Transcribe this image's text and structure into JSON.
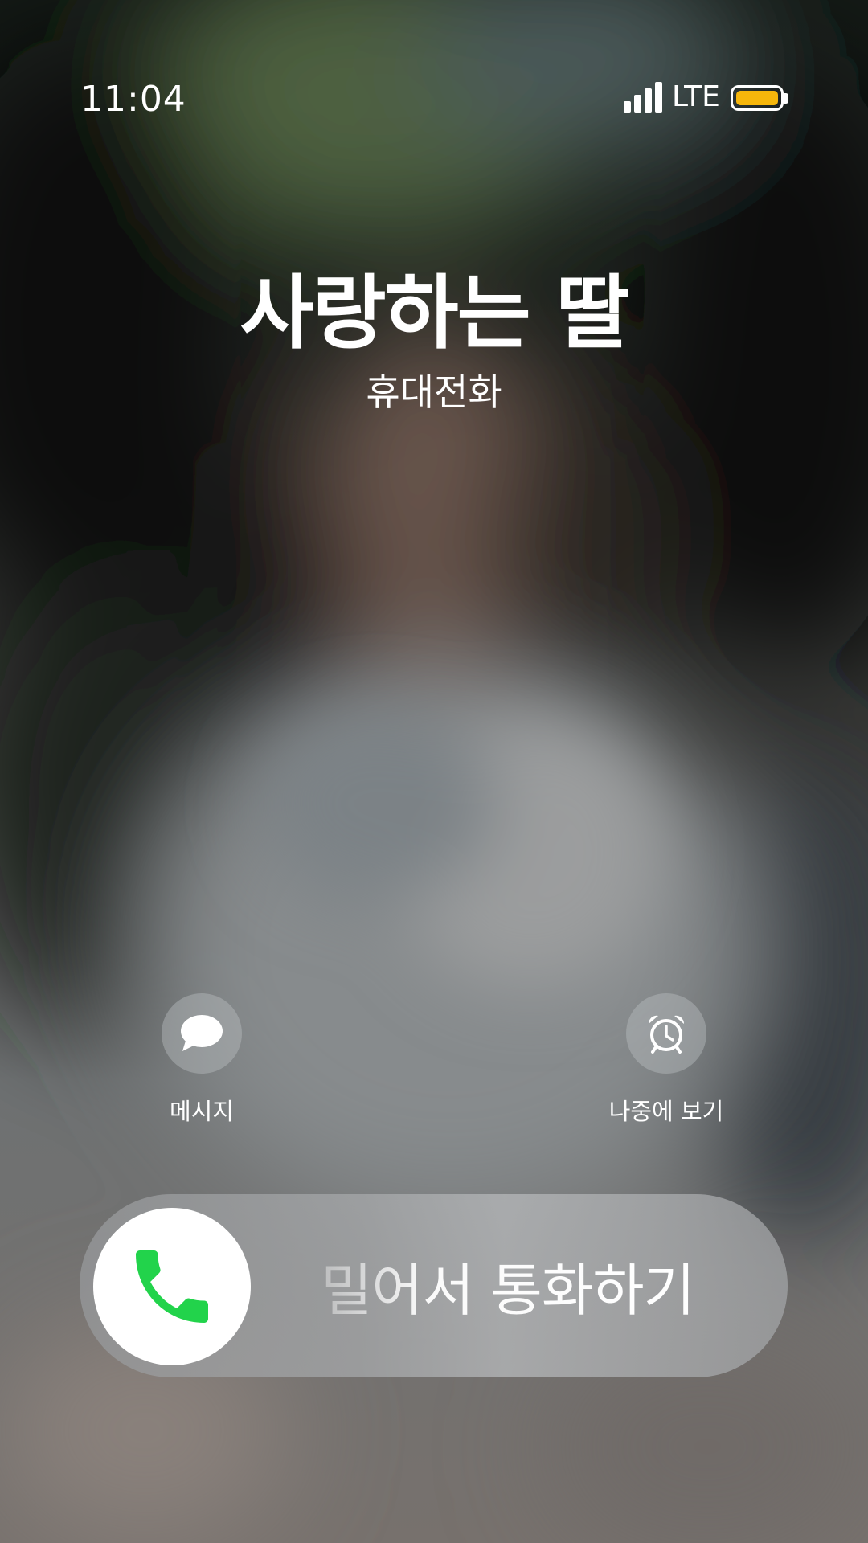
{
  "status_bar": {
    "time": "11:04",
    "network": "LTE",
    "icons": [
      "signal-icon",
      "battery-icon"
    ],
    "battery_color": "#f6b60b"
  },
  "caller": {
    "name": "사랑하는 딸",
    "type": "휴대전화"
  },
  "actions": {
    "message": {
      "label": "메시지",
      "icon": "message-bubble-icon"
    },
    "remind": {
      "label": "나중에 보기",
      "icon": "alarm-clock-icon"
    }
  },
  "slider": {
    "label": "밀어서 통화하기",
    "icon": "phone-icon",
    "accent": "#22d34b"
  }
}
